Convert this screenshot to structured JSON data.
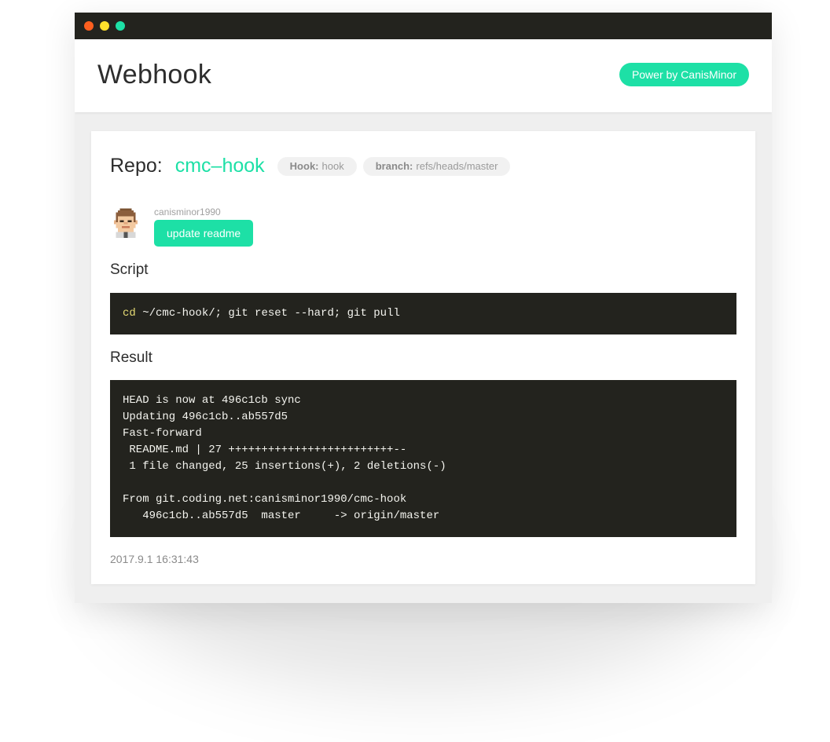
{
  "window": {
    "controls": [
      {
        "name": "close",
        "color": "#fd5f1f"
      },
      {
        "name": "minimize",
        "color": "#fde02c"
      },
      {
        "name": "zoom",
        "color": "#1de0a6"
      }
    ]
  },
  "header": {
    "title": "Webhook",
    "power_label": "Power by CanisMinor"
  },
  "repo": {
    "label": "Repo:",
    "name": "cmc–hook",
    "hook_key": "Hook:",
    "hook_value": "hook",
    "branch_key": "branch:",
    "branch_value": "refs/heads/master"
  },
  "commit": {
    "author": "canisminor1990",
    "message": "update readme",
    "avatar_icon": "pixel-avatar-icon"
  },
  "script": {
    "title": "Script",
    "command": "cd",
    "args": " ~/cmc-hook/; git reset --hard; git pull"
  },
  "result": {
    "title": "Result",
    "output": "HEAD is now at 496c1cb sync\nUpdating 496c1cb..ab557d5\nFast-forward\n README.md | 27 +++++++++++++++++++++++++--\n 1 file changed, 25 insertions(+), 2 deletions(-)\n\nFrom git.coding.net:canisminor1990/cmc-hook\n   496c1cb..ab557d5  master     -> origin/master"
  },
  "timestamp": "2017.9.1 16:31:43",
  "colors": {
    "accent": "#1de0a6",
    "terminal_bg": "#23231e",
    "command_keyword": "#e6db74"
  }
}
